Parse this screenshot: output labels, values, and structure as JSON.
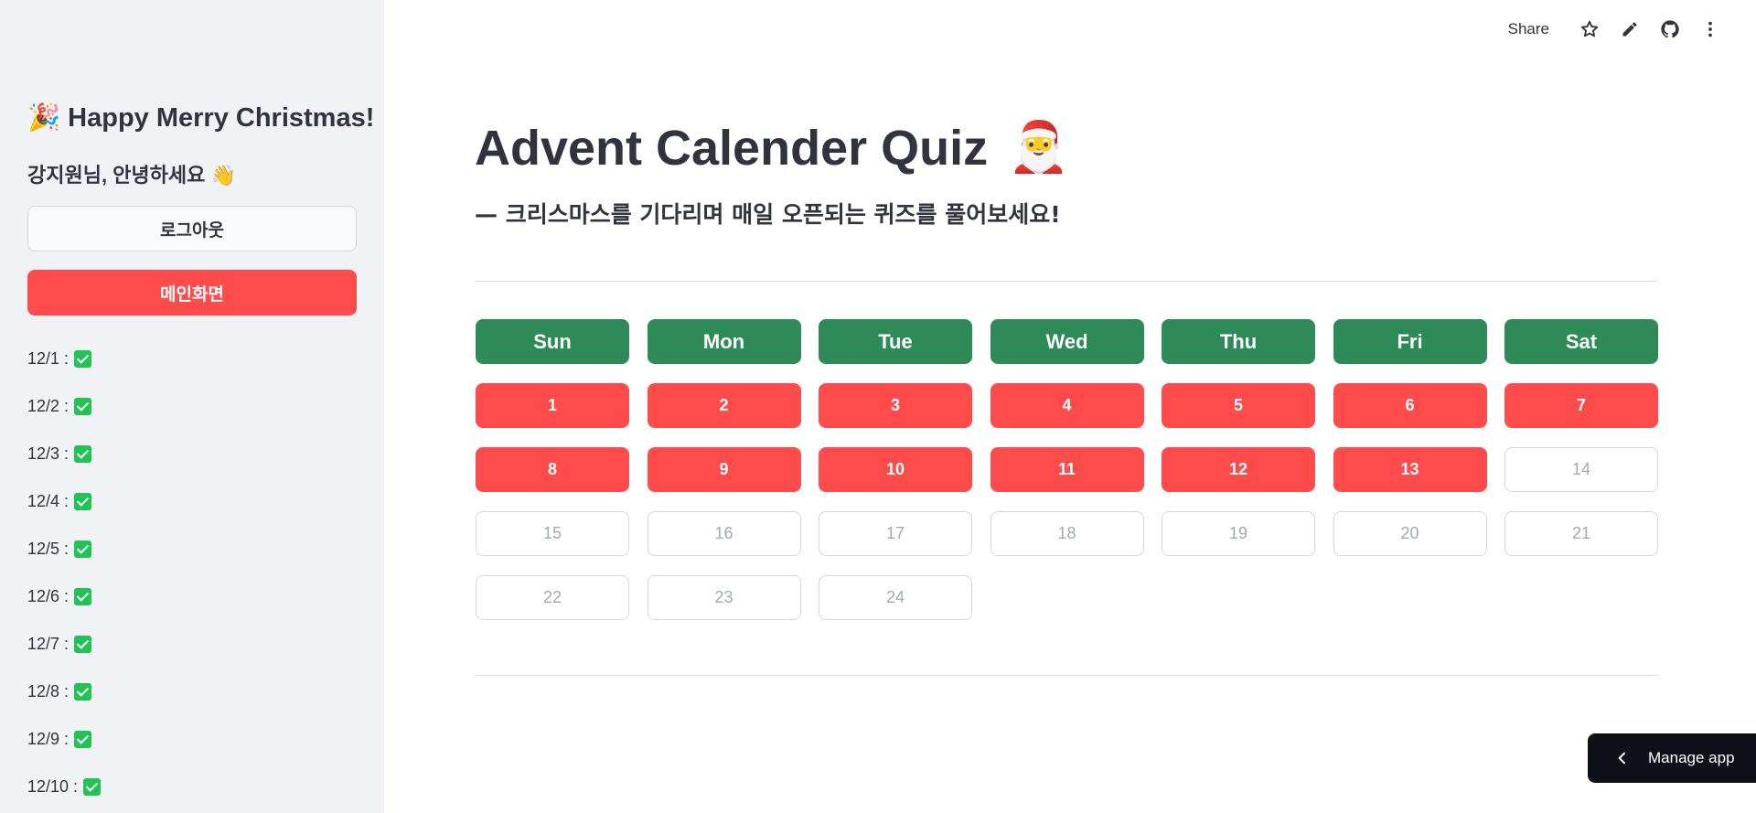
{
  "sidebar": {
    "title": "🎉 Happy Merry Christmas!",
    "greeting": "강지원님, 안녕하세요 👋",
    "logout_label": "로그아웃",
    "main_label": "메인화면",
    "progress": [
      {
        "date": "12/1 :",
        "done": true
      },
      {
        "date": "12/2 :",
        "done": true
      },
      {
        "date": "12/3 :",
        "done": true
      },
      {
        "date": "12/4 :",
        "done": true
      },
      {
        "date": "12/5 :",
        "done": true
      },
      {
        "date": "12/6 :",
        "done": true
      },
      {
        "date": "12/7 :",
        "done": true
      },
      {
        "date": "12/8 :",
        "done": true
      },
      {
        "date": "12/9 :",
        "done": true
      },
      {
        "date": "12/10 :",
        "done": true
      }
    ]
  },
  "toolbar": {
    "share_label": "Share",
    "icons": [
      "star-icon",
      "pencil-icon",
      "github-icon",
      "more-vertical-icon"
    ]
  },
  "main": {
    "title": "Advent Calender Quiz",
    "title_emoji": "🎅",
    "subtitle": "— 크리스마스를 기다리며 매일 오픈되는 퀴즈를 풀어보세요!"
  },
  "calendar": {
    "weekdays": [
      "Sun",
      "Mon",
      "Tue",
      "Wed",
      "Thu",
      "Fri",
      "Sat"
    ],
    "weeks": [
      [
        "1",
        "2",
        "3",
        "4",
        "5",
        "6",
        "7"
      ],
      [
        "8",
        "9",
        "10",
        "11",
        "12",
        "13",
        "14"
      ],
      [
        "15",
        "16",
        "17",
        "18",
        "19",
        "20",
        "21"
      ],
      [
        "22",
        "23",
        "24"
      ]
    ],
    "opened_through": 13
  },
  "manage_app": {
    "label": "Manage app"
  },
  "colors": {
    "accent_red": "#ff4b4b",
    "weekday_green": "#2e8b57",
    "check_green": "#21c354",
    "sidebar_bg": "#f0f2f6"
  }
}
